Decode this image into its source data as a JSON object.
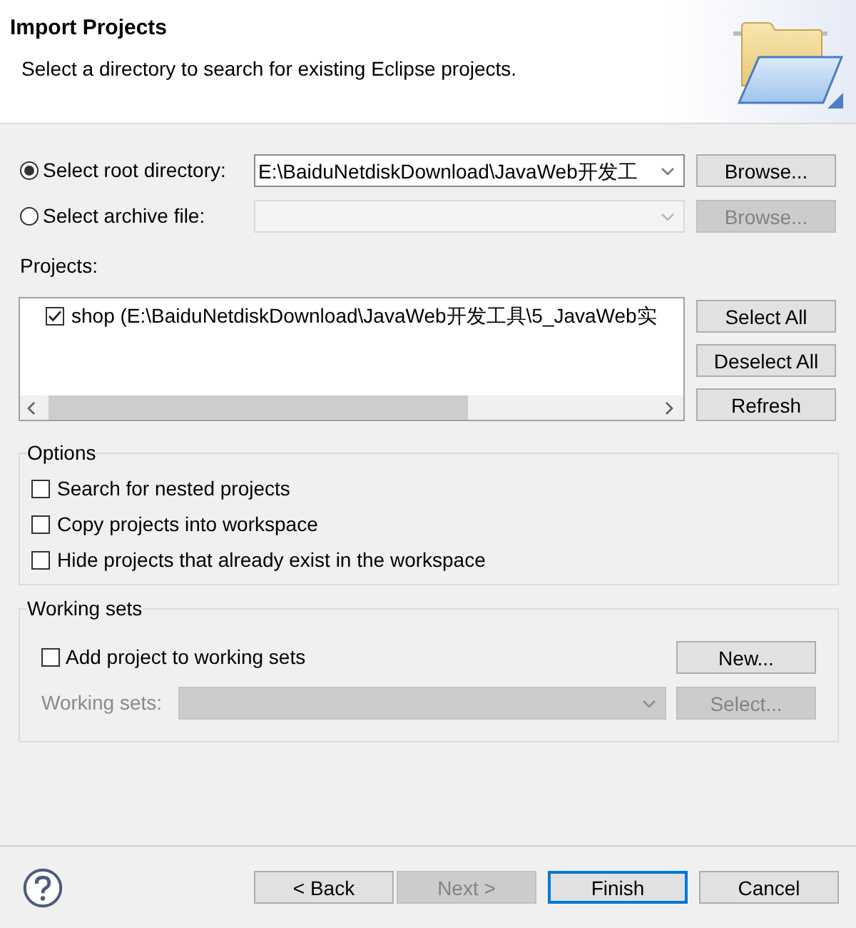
{
  "window": {
    "title": "Import Projects",
    "description": "Select a directory to search for existing Eclipse projects."
  },
  "source_options": [
    {
      "label": "Select root directory:",
      "selected": true,
      "value": "E:\\BaiduNetdiskDownload\\JavaWeb开发工",
      "disabled": false,
      "browse": {
        "label": "Browse...",
        "disabled": false
      }
    },
    {
      "label": "Select archive file:",
      "selected": false,
      "disabled": true,
      "browse": {
        "label": "Browse...",
        "disabled": true
      }
    }
  ],
  "projects": {
    "label": "Projects:",
    "items": [
      {
        "label": "shop (E:\\BaiduNetdiskDownload\\JavaWeb开发工具\\5_JavaWeb实",
        "checked": true
      }
    ],
    "buttons": [
      "Select All",
      "Deselect All",
      "Refresh"
    ]
  },
  "options": {
    "title": "Options",
    "items": [
      {
        "label": "Search for nested projects",
        "checked": false
      },
      {
        "label": "Copy projects into workspace",
        "checked": false
      },
      {
        "label": "Hide projects that already exist in the workspace",
        "checked": false
      }
    ]
  },
  "working_sets": {
    "title": "Working sets",
    "add": {
      "label": "Add project to working sets",
      "checked": false
    },
    "new_button": "New...",
    "field": {
      "label": "Working sets:",
      "disabled": true
    },
    "select_button": {
      "label": "Select...",
      "disabled": true
    }
  },
  "footer": {
    "buttons": [
      {
        "label": "< Back",
        "disabled": false,
        "default": false
      },
      {
        "label": "Next >",
        "disabled": true,
        "default": false
      },
      {
        "label": "Finish",
        "disabled": false,
        "default": true
      },
      {
        "label": "Cancel",
        "disabled": false,
        "default": false
      }
    ]
  }
}
